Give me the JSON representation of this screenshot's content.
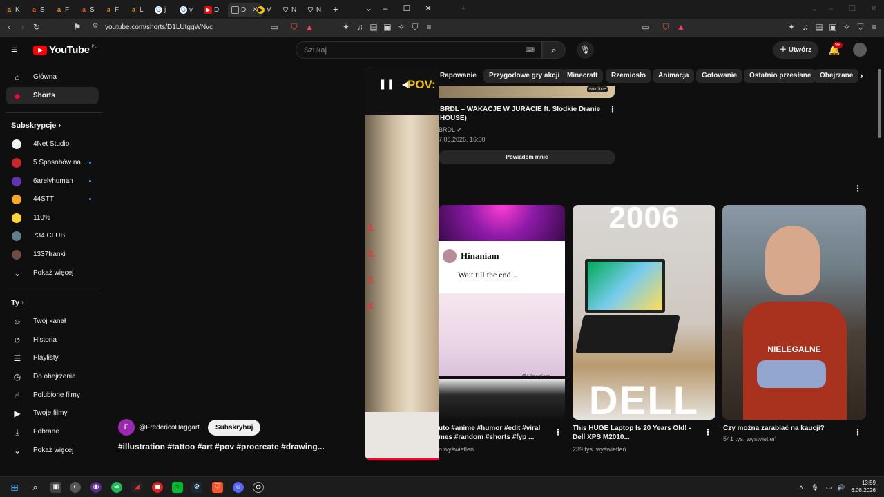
{
  "left_window": {
    "tabs": [
      {
        "icon": "amazon-icon",
        "text": "K"
      },
      {
        "icon": "allegro-icon",
        "text": "S"
      },
      {
        "icon": "amazon-icon",
        "text": "F"
      },
      {
        "icon": "allegro-icon",
        "text": "S"
      },
      {
        "icon": "amazon-icon",
        "text": "F"
      },
      {
        "icon": "amazon-icon",
        "text": "L"
      },
      {
        "icon": "google-icon",
        "text": "j"
      },
      {
        "icon": "google-icon",
        "text": "v"
      },
      {
        "icon": "youtube-icon",
        "text": "D"
      },
      {
        "icon": "page-icon",
        "text": "D"
      },
      {
        "icon": "player-icon",
        "text": "V"
      },
      {
        "icon": "shield-icon",
        "text": "N"
      },
      {
        "icon": "shield-icon",
        "text": "N"
      }
    ],
    "url": "youtube.com/shorts/D1LUtggWNvc",
    "logo_text": "YouTube",
    "logo_country": "PL",
    "search_placeholder": "Szukaj",
    "nav": [
      {
        "label": "Główna",
        "icon": "home-icon"
      },
      {
        "label": "Shorts",
        "icon": "shorts-icon"
      }
    ],
    "subscriptions_title": "Subskrypcje",
    "subscriptions": [
      {
        "name": "4Net Studio",
        "color": "#f0f0f0",
        "new": false
      },
      {
        "name": "5 Sposobów na...",
        "color": "#c62828",
        "new": true
      },
      {
        "name": "6arelyhuman",
        "color": "#5e35b1",
        "new": true
      },
      {
        "name": "44STT",
        "color": "#f9a825",
        "new": true
      },
      {
        "name": "110%",
        "color": "#fdd835",
        "new": false
      },
      {
        "name": "734 CLUB",
        "color": "#607d8b",
        "new": false
      },
      {
        "name": "1337franki",
        "color": "#6d4c41",
        "new": false
      }
    ],
    "show_more_1": "Pokaż więcej",
    "you_title": "Ty",
    "you_items": [
      {
        "label": "Twój kanał",
        "icon": "channel-icon"
      },
      {
        "label": "Historia",
        "icon": "history-icon"
      },
      {
        "label": "Playlisty",
        "icon": "playlist-icon"
      },
      {
        "label": "Do obejrzenia",
        "icon": "clock-icon"
      },
      {
        "label": "Polubione filmy",
        "icon": "like-icon"
      },
      {
        "label": "Twoje filmy",
        "icon": "video-icon"
      },
      {
        "label": "Pobrane",
        "icon": "download-icon"
      },
      {
        "label": "Pokaż więcej",
        "icon": "chevron-down-icon"
      }
    ],
    "short": {
      "pov_text": "POV:",
      "numbers": [
        "1.",
        "2.",
        "3.",
        "4."
      ],
      "channel_handle": "@FredericoHaggart",
      "channel_initial": "F",
      "subscribe_label": "Subskrybuj",
      "caption": "#illustration #tattoo #art #pov #procreate #drawing..."
    }
  },
  "right_window": {
    "create_label": "Utwórz",
    "notification_badge": "9+",
    "chips": [
      "Rapowanie",
      "Przygodowe gry akcji",
      "Minecraft",
      "Rzemiosło",
      "Animacja",
      "Gotowanie",
      "Ostatnio przesłane",
      "Obejrzane"
    ],
    "upcoming": {
      "badge": "wkrótce",
      "title_line1": "BRDL – WAKACJE W JURACIE ft. Słodkie Dranie",
      "title_line2": "HOUSE)",
      "channel": "BRDL",
      "date": "7.08.2026, 16:00",
      "notify_label": "Powiadom mnie"
    },
    "videos": [
      {
        "title_line1": "uto #anime #humor #edit #viral",
        "title_line2": "mes #random #shorts #fyp ...",
        "views": "n wyświetleń",
        "thumb_text1": "Hinaniam",
        "thumb_text2": "Wait till the end...",
        "thumb_tag": "@Hinaniam"
      },
      {
        "title_line1": "This HUGE Laptop Is 20 Years Old! -",
        "title_line2": "Dell XPS M2010...",
        "views": "239 tys. wyświetleń",
        "thumb_text1": "2006",
        "thumb_text2": "DELL"
      },
      {
        "title_line1": "Czy można zarabiać na kaucji?",
        "title_line2": "",
        "views": "541 tys. wyświetleń",
        "thumb_text1": "NIELEGALNE"
      }
    ]
  },
  "taskbar": {
    "time": "13:59",
    "date": "6.08.2026"
  }
}
